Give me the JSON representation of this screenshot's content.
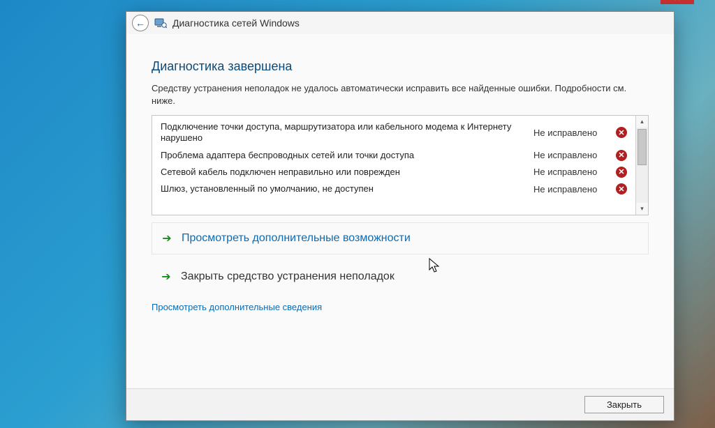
{
  "titlebar": {
    "title": "Диагностика сетей Windows"
  },
  "main": {
    "heading": "Диагностика завершена",
    "subtext": "Средству устранения неполадок не удалось автоматически исправить все найденные ошибки. Подробности см. ниже."
  },
  "issues": [
    {
      "desc": "Подключение точки доступа, маршрутизатора или кабельного модема к Интернету нарушено",
      "status": "Не исправлено"
    },
    {
      "desc": "Проблема адаптера беспроводных сетей или точки доступа",
      "status": "Не исправлено"
    },
    {
      "desc": "Сетевой кабель подключен неправильно или поврежден",
      "status": "Не исправлено"
    },
    {
      "desc": "Шлюз, установленный по умолчанию, не доступен",
      "status": "Не исправлено"
    }
  ],
  "options": {
    "more": "Просмотреть дополнительные возможности",
    "close_tool": "Закрыть средство устранения неполадок",
    "details_link": "Просмотреть дополнительные сведения"
  },
  "footer": {
    "close": "Закрыть"
  }
}
